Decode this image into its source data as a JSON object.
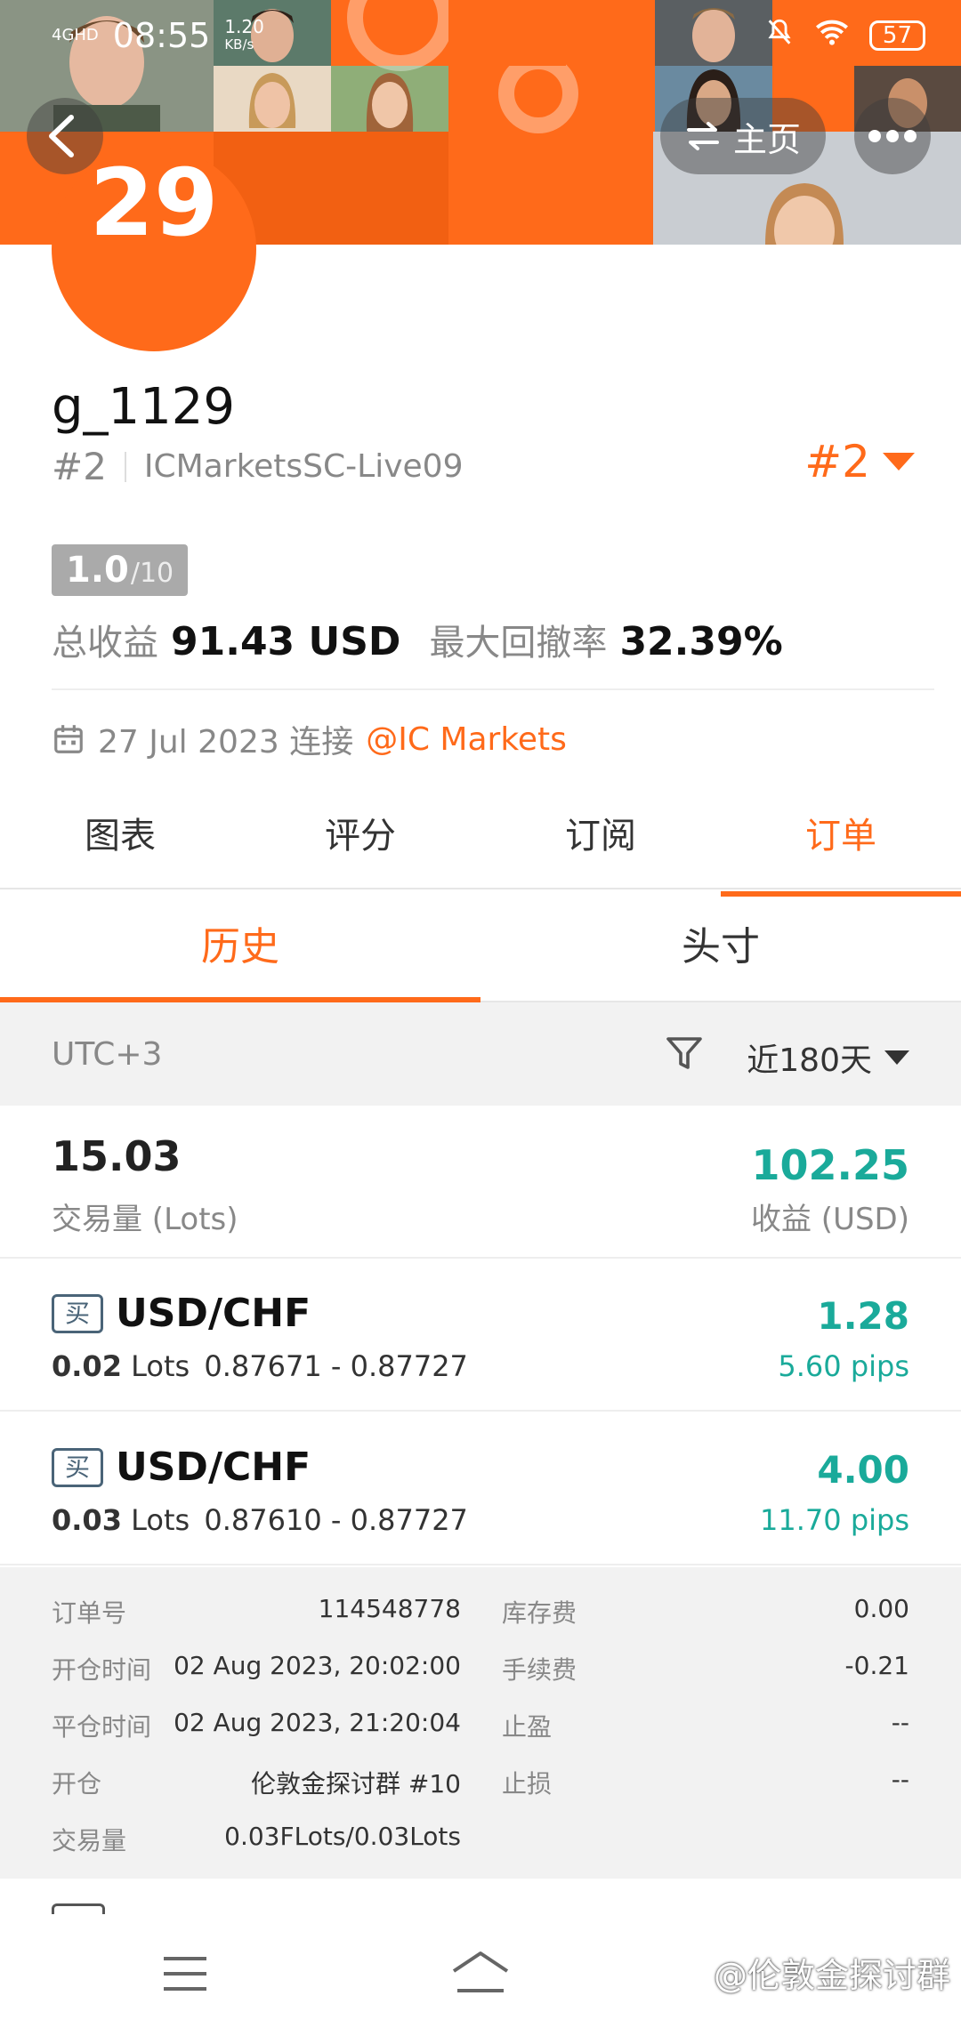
{
  "status_bar": {
    "network": "4GHD",
    "time": "08:55",
    "speed": "1.20",
    "speed_unit": "KB/s",
    "battery": "57"
  },
  "header": {
    "home_label": "主页"
  },
  "profile": {
    "rank_circle": "29",
    "username": "g_1129",
    "rank_hash": "#2",
    "server": "ICMarketsSC-Live09",
    "rank_right": "#2",
    "score_value": "1.0",
    "score_max": "/10",
    "total_profit_label": "总收益",
    "total_profit_value": "91.43 USD",
    "max_drawdown_label": "最大回撤率",
    "max_drawdown_value": "32.39%",
    "connected_date": "27 Jul 2023 连接",
    "broker": "@IC Markets"
  },
  "main_tabs": [
    "图表",
    "评分",
    "订阅",
    "订单"
  ],
  "sub_tabs": [
    "历史",
    "头寸"
  ],
  "filter": {
    "timezone": "UTC+3",
    "range": "近180天"
  },
  "totals": {
    "volume_value": "15.03",
    "volume_label": "交易量 (Lots)",
    "profit_value": "102.25",
    "profit_label": "收益 (USD)"
  },
  "trades": [
    {
      "side": "买",
      "symbol": "USD/CHF",
      "lots": "0.02",
      "lots_unit": "Lots",
      "prices": "0.87671 - 0.87727",
      "profit": "1.28",
      "pips": "5.60 pips"
    },
    {
      "side": "买",
      "symbol": "USD/CHF",
      "lots": "0.03",
      "lots_unit": "Lots",
      "prices": "0.87610 - 0.87727",
      "profit": "4.00",
      "pips": "11.70 pips"
    }
  ],
  "details": {
    "order_no_label": "订单号",
    "order_no": "114548778",
    "swap_label": "库存费",
    "swap": "0.00",
    "open_time_label": "开仓时间",
    "open_time": "02 Aug 2023, 20:02:00",
    "commission_label": "手续费",
    "commission": "-0.21",
    "close_time_label": "平仓时间",
    "close_time": "02 Aug 2023, 21:20:04",
    "tp_label": "止盈",
    "tp": "--",
    "open_label": "开仓",
    "open_source": "伦敦金探讨群 #10",
    "sl_label": "止损",
    "sl": "--",
    "volume_label": "交易量",
    "volume": "0.03FLots/0.03Lots"
  },
  "watermark": "@伦敦金探讨群",
  "colors": {
    "accent": "#ff6a1a",
    "profit": "#1aaa9a"
  }
}
